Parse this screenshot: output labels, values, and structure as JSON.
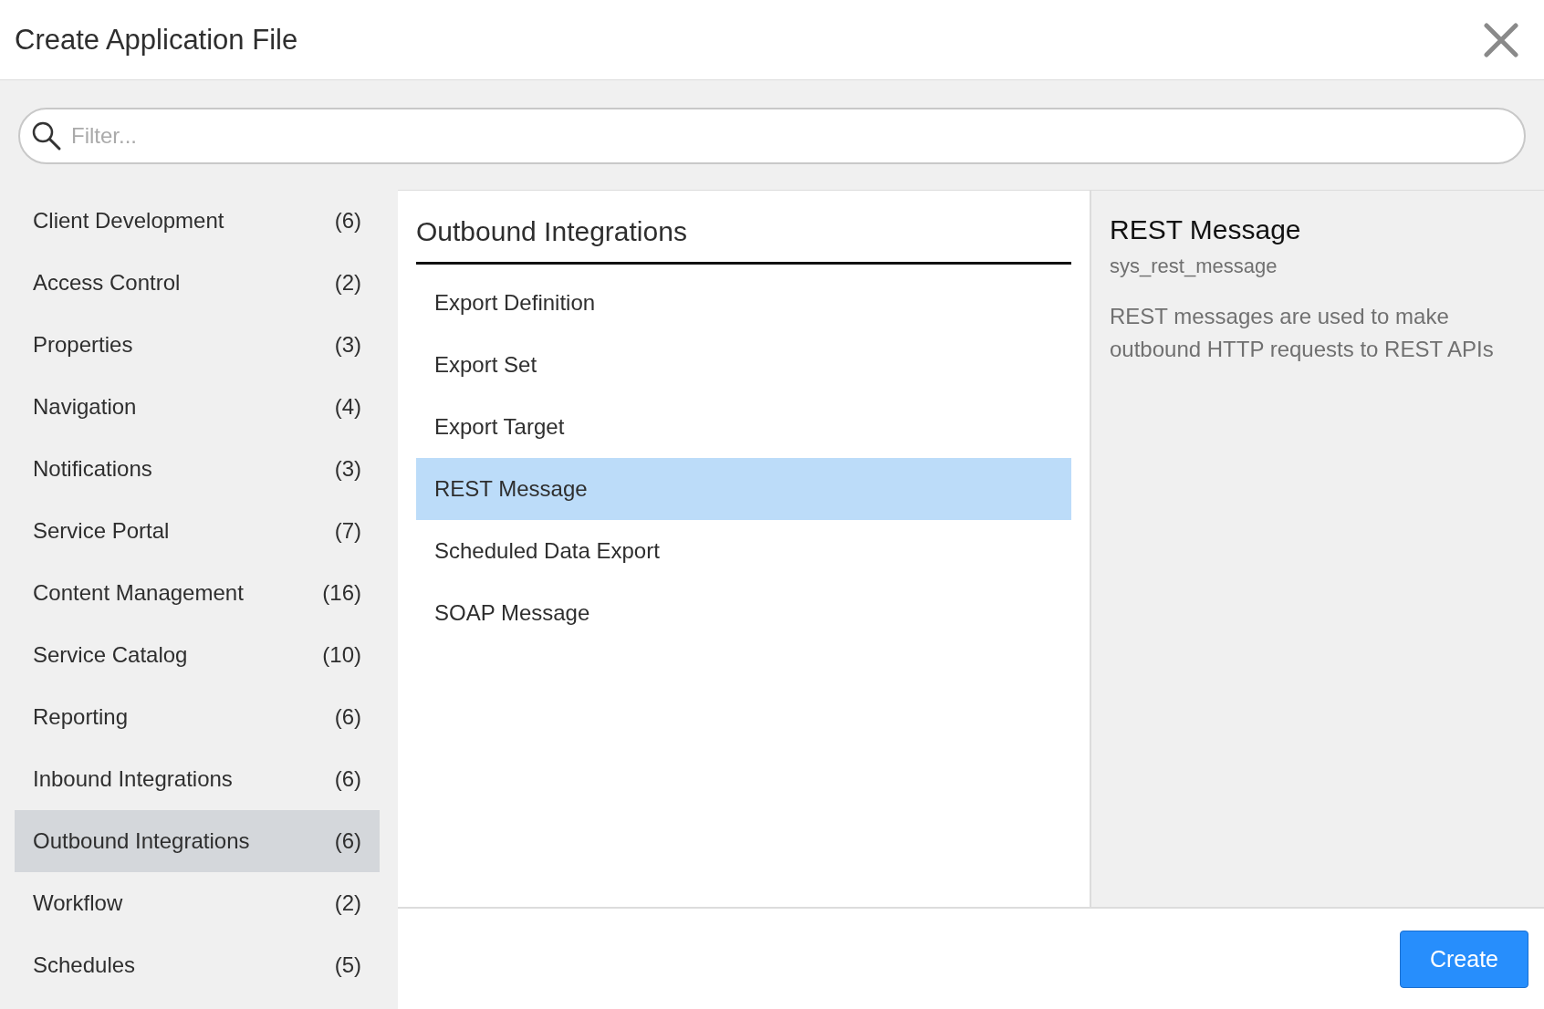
{
  "window": {
    "title": "Create Application File"
  },
  "filter": {
    "placeholder": "Filter..."
  },
  "categories": [
    {
      "label": "Client Development",
      "count": "(6)",
      "selected": false
    },
    {
      "label": "Access Control",
      "count": "(2)",
      "selected": false
    },
    {
      "label": "Properties",
      "count": "(3)",
      "selected": false
    },
    {
      "label": "Navigation",
      "count": "(4)",
      "selected": false
    },
    {
      "label": "Notifications",
      "count": "(3)",
      "selected": false
    },
    {
      "label": "Service Portal",
      "count": "(7)",
      "selected": false
    },
    {
      "label": "Content Management",
      "count": "(16)",
      "selected": false
    },
    {
      "label": "Service Catalog",
      "count": "(10)",
      "selected": false
    },
    {
      "label": "Reporting",
      "count": "(6)",
      "selected": false
    },
    {
      "label": "Inbound Integrations",
      "count": "(6)",
      "selected": false
    },
    {
      "label": "Outbound Integrations",
      "count": "(6)",
      "selected": true
    },
    {
      "label": "Workflow",
      "count": "(2)",
      "selected": false
    },
    {
      "label": "Schedules",
      "count": "(5)",
      "selected": false
    }
  ],
  "file_types": {
    "heading": "Outbound Integrations",
    "items": [
      {
        "label": "Export Definition",
        "selected": false
      },
      {
        "label": "Export Set",
        "selected": false
      },
      {
        "label": "Export Target",
        "selected": false
      },
      {
        "label": "REST Message",
        "selected": true
      },
      {
        "label": "Scheduled Data Export",
        "selected": false
      },
      {
        "label": "SOAP Message",
        "selected": false
      }
    ]
  },
  "details": {
    "title": "REST Message",
    "table": "sys_rest_message",
    "description": "REST messages are used to make outbound HTTP requests to REST APIs"
  },
  "buttons": [
    {
      "label": "Create"
    }
  ]
}
